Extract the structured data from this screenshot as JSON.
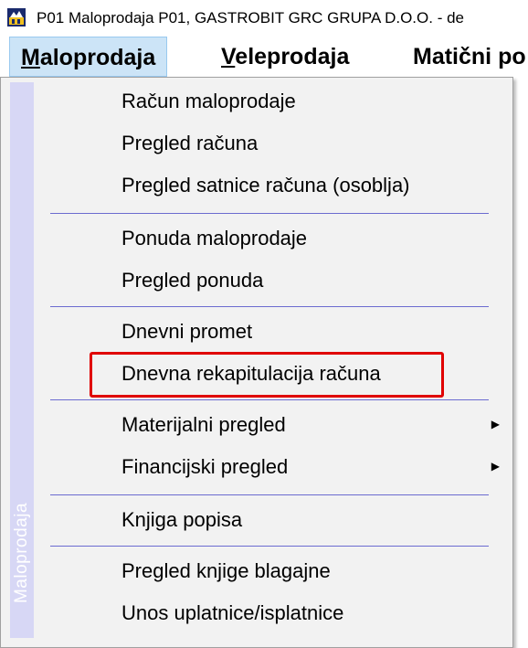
{
  "window": {
    "title": "P01 Maloprodaja P01, GASTROBIT GRC GRUPA D.O.O. - de"
  },
  "menubar": {
    "items": [
      {
        "label": "Maloprodaja",
        "accel": "M",
        "rest": "aloprodaja"
      },
      {
        "label": "Veleprodaja",
        "accel": "V",
        "rest": "eleprodaja"
      },
      {
        "label": "Matični po",
        "prefix": "Matični po"
      }
    ]
  },
  "dropdown": {
    "side_label": "Maloprodaja",
    "items": [
      {
        "label": "Račun maloprodaje"
      },
      {
        "label": "Pregled računa"
      },
      {
        "label": "Pregled satnice računa (osoblja)"
      },
      {
        "label": "Ponuda maloprodaje"
      },
      {
        "label": "Pregled ponuda"
      },
      {
        "label": "Dnevni promet"
      },
      {
        "label": "Dnevna rekapitulacija računa"
      },
      {
        "label": "Materijalni pregled",
        "submenu_glyph": "▶"
      },
      {
        "label": "Financijski pregled",
        "submenu_glyph": "▶"
      },
      {
        "label": "Knjiga popisa"
      },
      {
        "label": "Pregled knjige blagajne"
      },
      {
        "label": "Unos uplatnice/isplatnice"
      }
    ]
  },
  "colors": {
    "highlight": "#e00000",
    "separator": "#6b6bd0",
    "side_strip": "#d7d7f5"
  }
}
